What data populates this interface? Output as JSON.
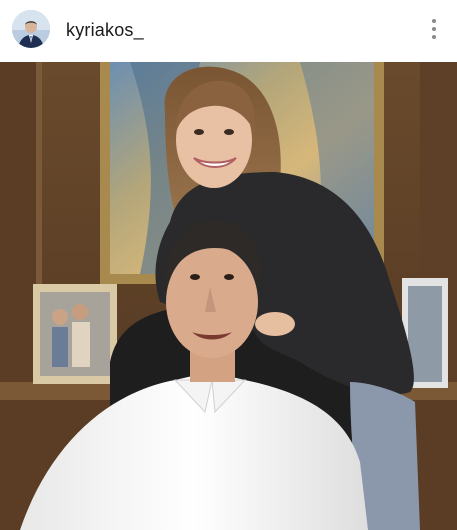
{
  "post": {
    "username": "kyriakos_",
    "avatar_icon": "profile-avatar",
    "more_icon": "more-vertical-icon",
    "photo_description_icon": "post-photo"
  },
  "colors": {
    "header_bg": "#ffffff",
    "username_text": "#1a1a1a",
    "more_dots": "#8a8a8a"
  }
}
